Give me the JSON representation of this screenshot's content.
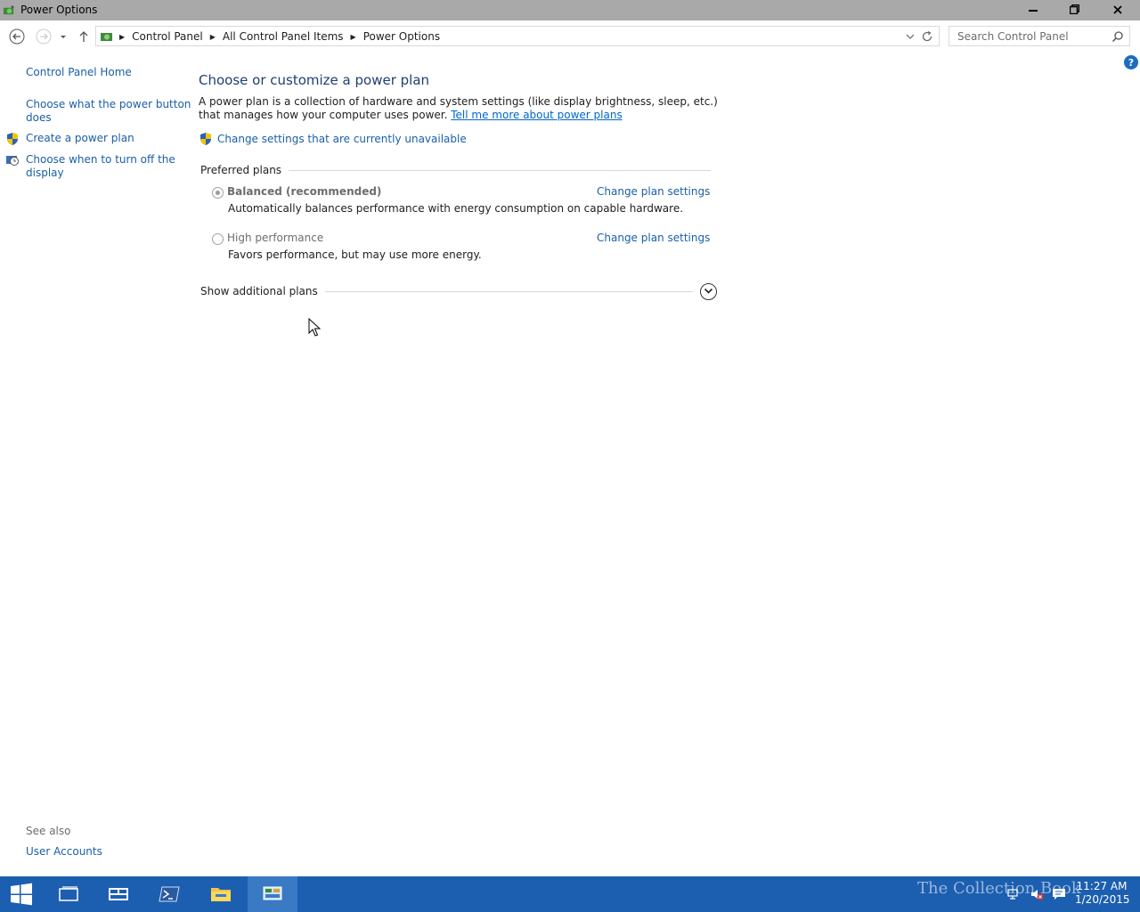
{
  "window": {
    "title": "Power Options",
    "minimize": "–",
    "maximize": "❐",
    "close": "✕"
  },
  "address": {
    "crumbs": [
      "Control Panel",
      "All Control Panel Items",
      "Power Options"
    ],
    "search_placeholder": "Search Control Panel"
  },
  "sidebar": {
    "home": "Control Panel Home",
    "items": [
      {
        "label": "Choose what the power button does",
        "line1": "Choose what the power button",
        "line2": "does"
      },
      {
        "label": "Create a power plan"
      },
      {
        "label": "Choose when to turn off the display",
        "line1": "Choose when to turn off the",
        "line2": "display"
      }
    ],
    "see_also": "See also",
    "user_accounts": "User Accounts"
  },
  "main": {
    "title": "Choose or customize a power plan",
    "description": "A power plan is a collection of hardware and system settings (like display brightness, sleep, etc.) that manages how your computer uses power.",
    "learn_more": "Tell me more about power plans",
    "change_unavailable": "Change settings that are currently unavailable",
    "preferred_header": "Preferred plans",
    "plans": [
      {
        "name": "Balanced (recommended)",
        "selected": true,
        "settings_link": "Change plan settings",
        "description": "Automatically balances performance with energy consumption on capable hardware."
      },
      {
        "name": "High performance",
        "selected": false,
        "settings_link": "Change plan settings",
        "description": "Favors performance, but may use more energy."
      }
    ],
    "additional_plans": "Show additional plans"
  },
  "help": "?",
  "taskbar": {
    "time": "11:27 AM",
    "date": "1/20/2015",
    "watermark": "The Collection Book"
  },
  "colors": {
    "titlebar": "#a9a9a9",
    "link": "#1a5fa8",
    "heading": "#1e3f73",
    "taskbar": "#1c5fb0"
  }
}
